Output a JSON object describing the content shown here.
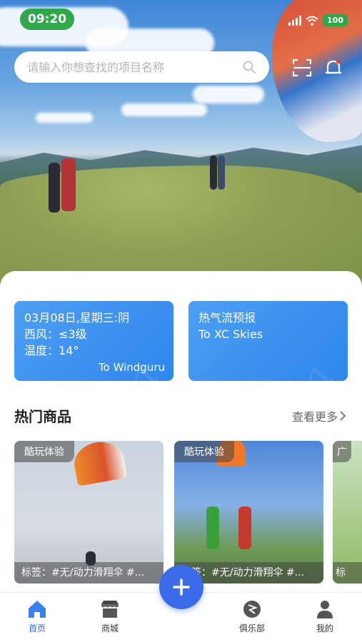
{
  "status_bar": {
    "time": "09:20",
    "battery": "100"
  },
  "search": {
    "placeholder": "请输入你想查找的项目名称"
  },
  "weather_card": {
    "line1": "03月08日,星期三:阴",
    "line2": "西风：≤3级",
    "line3": "温度：14°",
    "link": "To Windguru"
  },
  "thermal_card": {
    "title": "热气流预报",
    "subtitle": "To XC Skies"
  },
  "hot_products": {
    "title": "热门商品",
    "see_more": "查看更多",
    "items": [
      {
        "tag": "酷玩体验",
        "label": "标签：#无/动力滑翔伞 #..."
      },
      {
        "tag": "酷玩体验",
        "label": "标签：#无/动力滑翔伞 #..."
      },
      {
        "tag": "广",
        "label": "标"
      }
    ]
  },
  "tabbar": {
    "items": [
      {
        "label": "首页",
        "icon": "home-icon"
      },
      {
        "label": "商城",
        "icon": "shop-icon"
      },
      {
        "label": "俱乐部",
        "icon": "club-icon"
      },
      {
        "label": "我的",
        "icon": "profile-icon"
      }
    ],
    "fab_icon": "plus-icon"
  },
  "colors": {
    "accent": "#2f6fe6",
    "card": "#3a8ff0",
    "status_green": "#31a74b"
  }
}
